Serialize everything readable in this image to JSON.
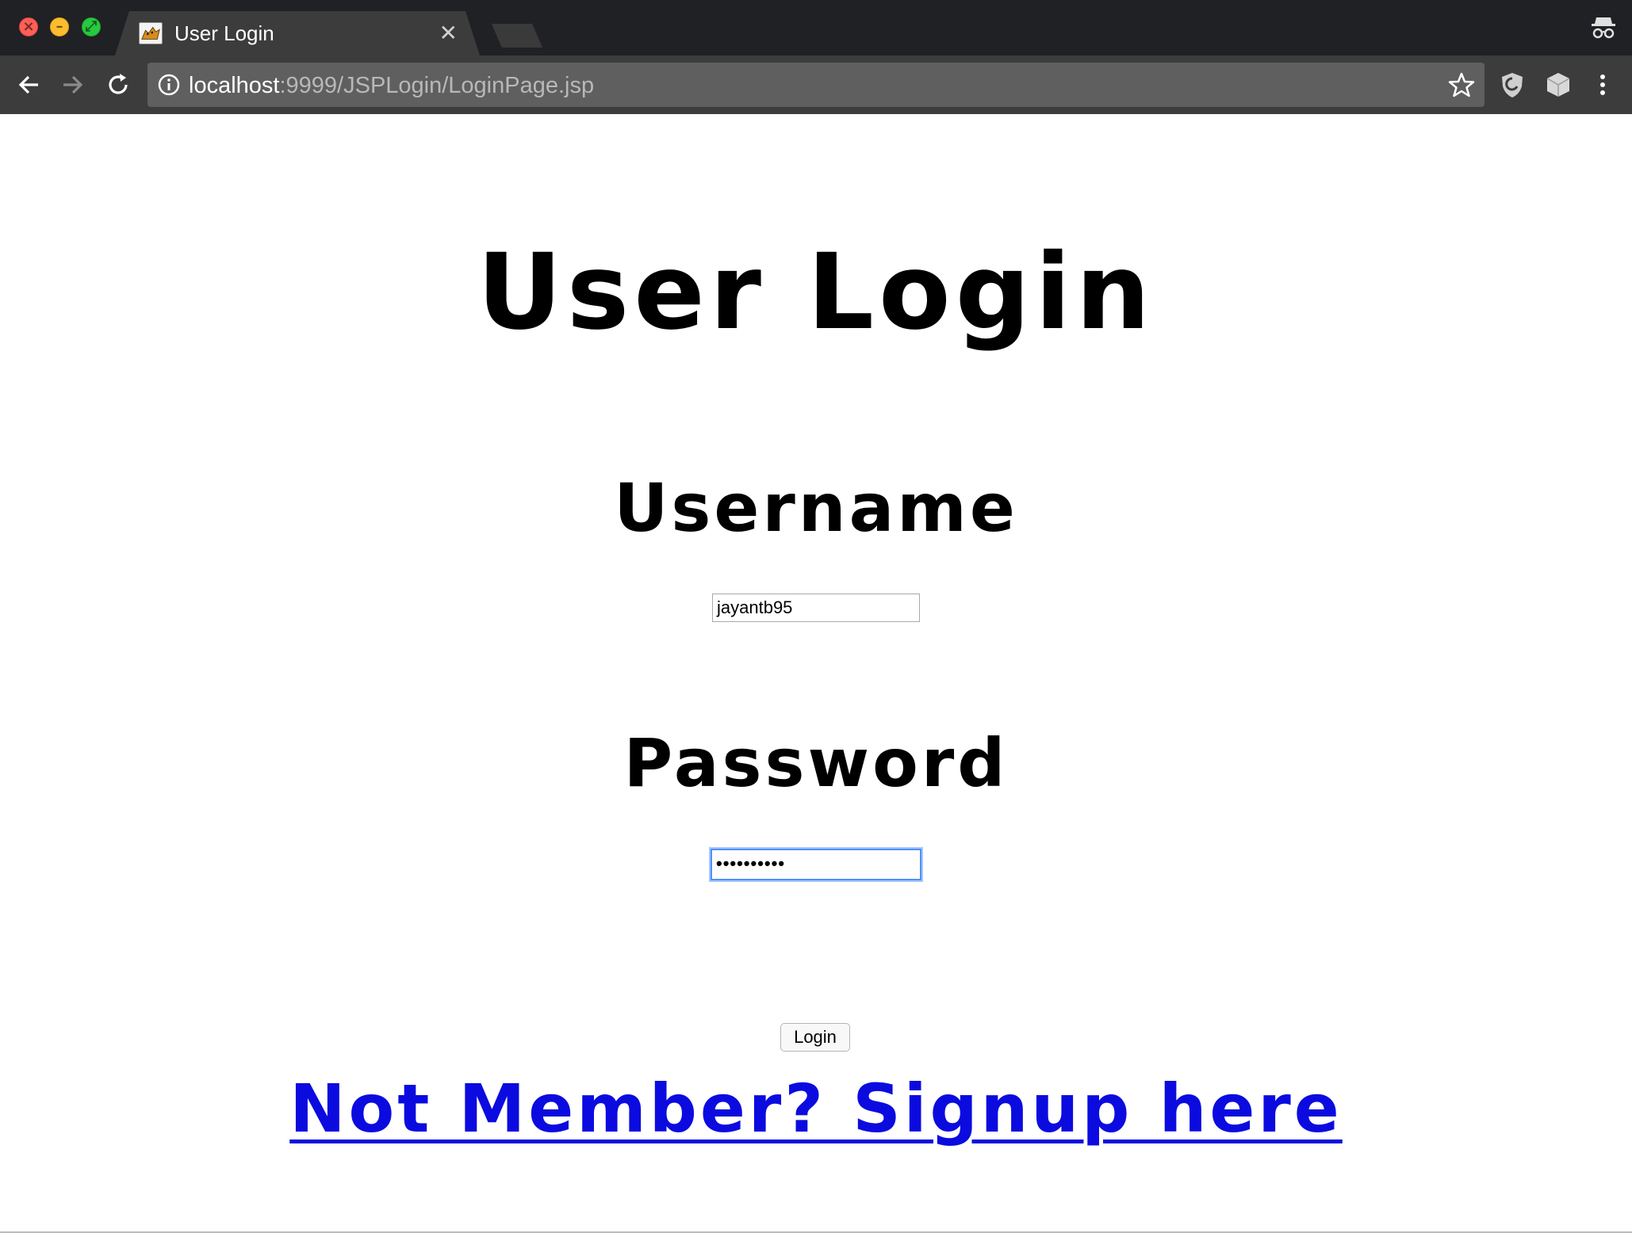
{
  "window_controls": {
    "close_glyph": "×",
    "minimize_glyph": "–",
    "maximize_glyph": "⤢"
  },
  "tab": {
    "title": "User Login",
    "close_glyph": "✕",
    "favicon": "tomcat-favicon-icon"
  },
  "toolbar": {
    "url_host": "localhost",
    "url_rest": ":9999/JSPLogin/LoginPage.jsp"
  },
  "page": {
    "title": "User Login",
    "username_label": "Username",
    "username_value": "jayantb95",
    "password_label": "Password",
    "password_value": "••••••••••",
    "login_button": "Login",
    "signup_link": "Not Member? Signup here"
  },
  "colors": {
    "link": "#0b0be0",
    "tab_strip": "#202124",
    "toolbar": "#3c3c3c",
    "focus_ring": "#4d90fe"
  }
}
